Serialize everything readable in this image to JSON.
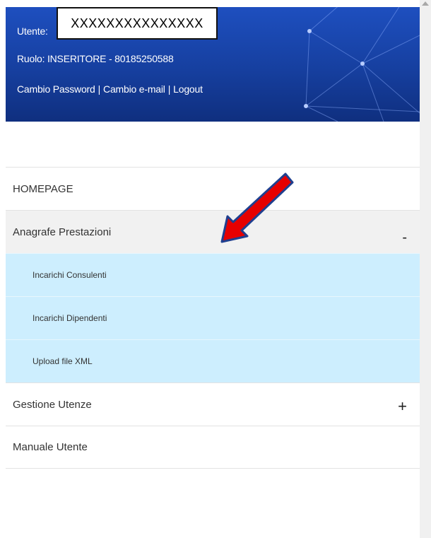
{
  "header": {
    "user_label": "Utente:",
    "user_value": "XXXXXXXXXXXXXXX",
    "role_text": "Ruolo: INSERITORE - 80185250588",
    "links": {
      "change_password": "Cambio Password",
      "change_email": "Cambio e-mail",
      "logout": "Logout",
      "separator": "|"
    }
  },
  "menu": {
    "homepage": "HOMEPAGE",
    "anagrafe": {
      "label": "Anagrafe Prestazioni",
      "toggle": "-"
    },
    "sub_items": [
      "Incarichi Consulenti",
      "Incarichi Dipendenti",
      "Upload file XML"
    ],
    "gestione": {
      "label": "Gestione Utenze",
      "toggle": "+"
    },
    "manuale": "Manuale Utente"
  },
  "colors": {
    "header_blue": "#1e4fbf",
    "submenu_bg": "#cdeefe",
    "active_bg": "#f1f1f1",
    "annotation_arrow": "#e60000"
  }
}
